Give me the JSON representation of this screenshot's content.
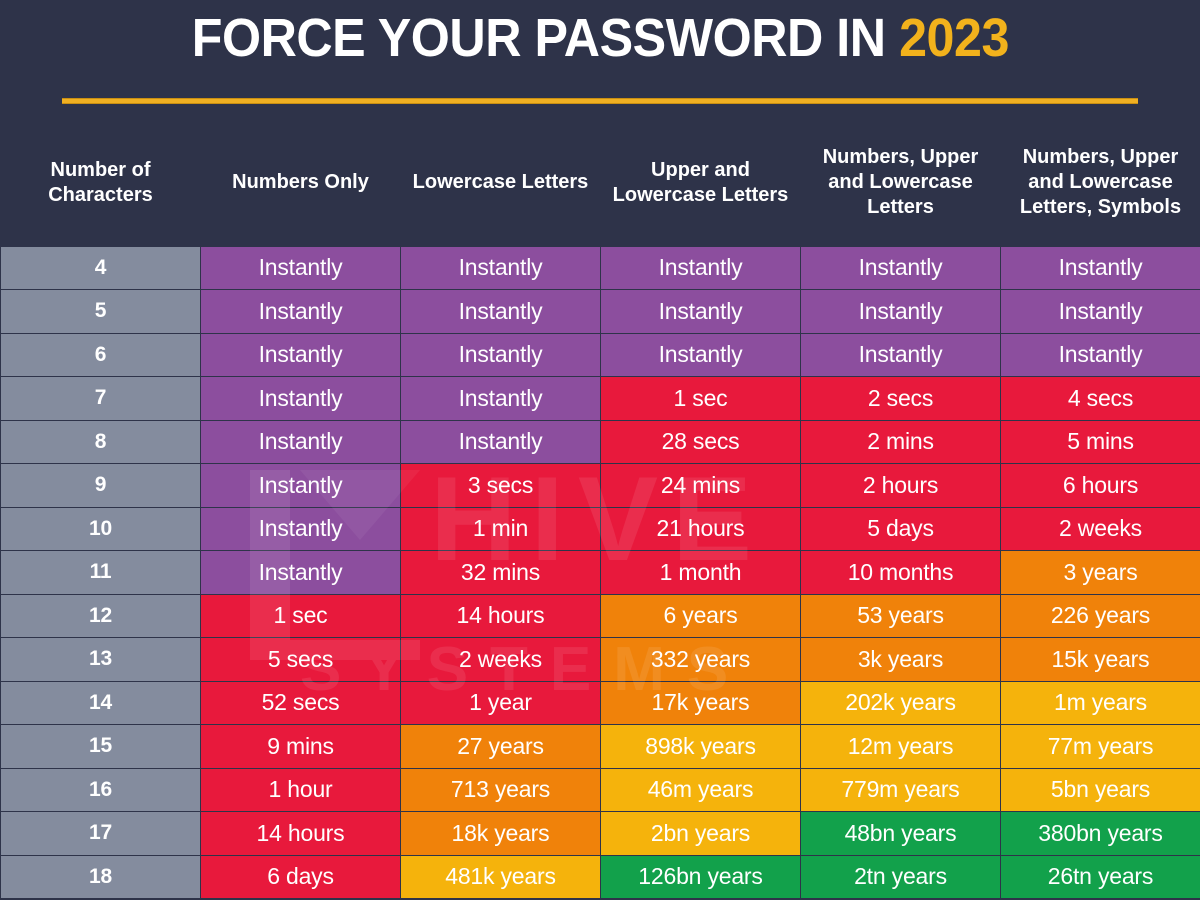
{
  "title": {
    "main": "FORCE YOUR PASSWORD IN ",
    "year": "2023"
  },
  "colors": {
    "background": "#2e3349",
    "accent_gold": "#f0b022",
    "instant_purple": "#8c4e9e",
    "danger_red": "#e8193c",
    "warn_orange": "#f0820a",
    "caution_yellow": "#f5b30c",
    "safe_green": "#12a14b",
    "rowhead_gray": "#848c9e"
  },
  "table": {
    "headers": [
      "Number of Characters",
      "Numbers Only",
      "Lowercase Letters",
      "Upper and Lowercase Letters",
      "Numbers, Upper and Lowercase Letters",
      "Numbers, Upper and Lowercase Letters, Symbols"
    ],
    "rows": [
      {
        "chars": "4",
        "cells": [
          {
            "text": "Instantly",
            "color": "purple"
          },
          {
            "text": "Instantly",
            "color": "purple"
          },
          {
            "text": "Instantly",
            "color": "purple"
          },
          {
            "text": "Instantly",
            "color": "purple"
          },
          {
            "text": "Instantly",
            "color": "purple"
          }
        ]
      },
      {
        "chars": "5",
        "cells": [
          {
            "text": "Instantly",
            "color": "purple"
          },
          {
            "text": "Instantly",
            "color": "purple"
          },
          {
            "text": "Instantly",
            "color": "purple"
          },
          {
            "text": "Instantly",
            "color": "purple"
          },
          {
            "text": "Instantly",
            "color": "purple"
          }
        ]
      },
      {
        "chars": "6",
        "cells": [
          {
            "text": "Instantly",
            "color": "purple"
          },
          {
            "text": "Instantly",
            "color": "purple"
          },
          {
            "text": "Instantly",
            "color": "purple"
          },
          {
            "text": "Instantly",
            "color": "purple"
          },
          {
            "text": "Instantly",
            "color": "purple"
          }
        ]
      },
      {
        "chars": "7",
        "cells": [
          {
            "text": "Instantly",
            "color": "purple"
          },
          {
            "text": "Instantly",
            "color": "purple"
          },
          {
            "text": "1 sec",
            "color": "red"
          },
          {
            "text": "2 secs",
            "color": "red"
          },
          {
            "text": "4 secs",
            "color": "red"
          }
        ]
      },
      {
        "chars": "8",
        "cells": [
          {
            "text": "Instantly",
            "color": "purple"
          },
          {
            "text": "Instantly",
            "color": "purple"
          },
          {
            "text": "28 secs",
            "color": "red"
          },
          {
            "text": "2 mins",
            "color": "red"
          },
          {
            "text": "5 mins",
            "color": "red"
          }
        ]
      },
      {
        "chars": "9",
        "cells": [
          {
            "text": "Instantly",
            "color": "purple"
          },
          {
            "text": "3 secs",
            "color": "red"
          },
          {
            "text": "24 mins",
            "color": "red"
          },
          {
            "text": "2 hours",
            "color": "red"
          },
          {
            "text": "6 hours",
            "color": "red"
          }
        ]
      },
      {
        "chars": "10",
        "cells": [
          {
            "text": "Instantly",
            "color": "purple"
          },
          {
            "text": "1 min",
            "color": "red"
          },
          {
            "text": "21 hours",
            "color": "red"
          },
          {
            "text": "5 days",
            "color": "red"
          },
          {
            "text": "2 weeks",
            "color": "red"
          }
        ]
      },
      {
        "chars": "11",
        "cells": [
          {
            "text": "Instantly",
            "color": "purple"
          },
          {
            "text": "32 mins",
            "color": "red"
          },
          {
            "text": "1 month",
            "color": "red"
          },
          {
            "text": "10 months",
            "color": "red"
          },
          {
            "text": "3 years",
            "color": "orange"
          }
        ]
      },
      {
        "chars": "12",
        "cells": [
          {
            "text": "1 sec",
            "color": "red"
          },
          {
            "text": "14 hours",
            "color": "red"
          },
          {
            "text": "6 years",
            "color": "orange"
          },
          {
            "text": "53 years",
            "color": "orange"
          },
          {
            "text": "226 years",
            "color": "orange"
          }
        ]
      },
      {
        "chars": "13",
        "cells": [
          {
            "text": "5 secs",
            "color": "red"
          },
          {
            "text": "2 weeks",
            "color": "red"
          },
          {
            "text": "332 years",
            "color": "orange"
          },
          {
            "text": "3k years",
            "color": "orange"
          },
          {
            "text": "15k years",
            "color": "orange"
          }
        ]
      },
      {
        "chars": "14",
        "cells": [
          {
            "text": "52 secs",
            "color": "red"
          },
          {
            "text": "1 year",
            "color": "red"
          },
          {
            "text": "17k years",
            "color": "orange"
          },
          {
            "text": "202k years",
            "color": "yellow"
          },
          {
            "text": "1m years",
            "color": "yellow"
          }
        ]
      },
      {
        "chars": "15",
        "cells": [
          {
            "text": "9 mins",
            "color": "red"
          },
          {
            "text": "27 years",
            "color": "orange"
          },
          {
            "text": "898k years",
            "color": "yellow"
          },
          {
            "text": "12m years",
            "color": "yellow"
          },
          {
            "text": "77m years",
            "color": "yellow"
          }
        ]
      },
      {
        "chars": "16",
        "cells": [
          {
            "text": "1 hour",
            "color": "red"
          },
          {
            "text": "713 years",
            "color": "orange"
          },
          {
            "text": "46m years",
            "color": "yellow"
          },
          {
            "text": "779m years",
            "color": "yellow"
          },
          {
            "text": "5bn years",
            "color": "yellow"
          }
        ]
      },
      {
        "chars": "17",
        "cells": [
          {
            "text": "14 hours",
            "color": "red"
          },
          {
            "text": "18k years",
            "color": "orange"
          },
          {
            "text": "2bn years",
            "color": "yellow"
          },
          {
            "text": "48bn years",
            "color": "green"
          },
          {
            "text": "380bn years",
            "color": "green"
          }
        ]
      },
      {
        "chars": "18",
        "cells": [
          {
            "text": "6 days",
            "color": "red"
          },
          {
            "text": "481k years",
            "color": "yellow"
          },
          {
            "text": "126bn years",
            "color": "green"
          },
          {
            "text": "2tn years",
            "color": "green"
          },
          {
            "text": "26tn years",
            "color": "green"
          }
        ]
      }
    ]
  }
}
